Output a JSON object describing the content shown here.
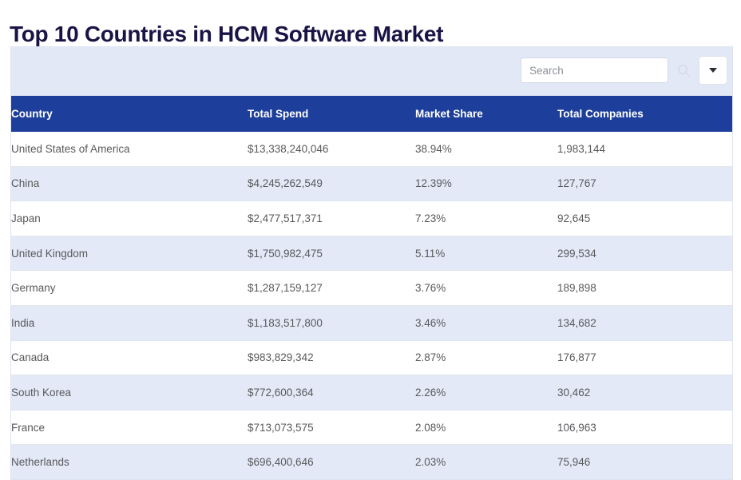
{
  "page": {
    "title": "Top 10 Countries in HCM Software Market"
  },
  "toolbar": {
    "search_placeholder": "Search",
    "search_value": "",
    "search_icon": "search-icon",
    "dropdown_icon": "chevron-down-icon"
  },
  "table": {
    "columns": [
      {
        "key": "country",
        "label": "Country"
      },
      {
        "key": "spend",
        "label": "Total Spend"
      },
      {
        "key": "share",
        "label": "Market Share"
      },
      {
        "key": "companies",
        "label": "Total Companies"
      }
    ],
    "rows": [
      {
        "country": "United States of America",
        "spend": "$13,338,240,046",
        "share": "38.94%",
        "companies": "1,983,144"
      },
      {
        "country": "China",
        "spend": "$4,245,262,549",
        "share": "12.39%",
        "companies": "127,767"
      },
      {
        "country": "Japan",
        "spend": "$2,477,517,371",
        "share": "7.23%",
        "companies": "92,645"
      },
      {
        "country": "United Kingdom",
        "spend": "$1,750,982,475",
        "share": "5.11%",
        "companies": "299,534"
      },
      {
        "country": "Germany",
        "spend": "$1,287,159,127",
        "share": "3.76%",
        "companies": "189,898"
      },
      {
        "country": "India",
        "spend": "$1,183,517,800",
        "share": "3.46%",
        "companies": "134,682"
      },
      {
        "country": "Canada",
        "spend": "$983,829,342",
        "share": "2.87%",
        "companies": "176,877"
      },
      {
        "country": "South Korea",
        "spend": "$772,600,364",
        "share": "2.26%",
        "companies": "30,462"
      },
      {
        "country": "France",
        "spend": "$713,073,575",
        "share": "2.08%",
        "companies": "106,963"
      },
      {
        "country": "Netherlands",
        "spend": "$696,400,646",
        "share": "2.03%",
        "companies": "75,946"
      }
    ]
  },
  "colors": {
    "title": "#1a1446",
    "header_bg": "#1d3f9b",
    "toolbar_bg": "#e2e8f6",
    "row_alt_bg": "#e3e9f7",
    "body_text": "#58595b"
  }
}
